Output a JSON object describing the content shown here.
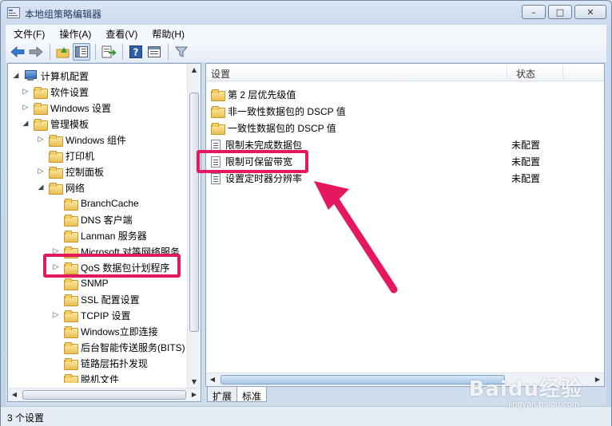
{
  "window": {
    "title": "本地组策略编辑器"
  },
  "menubar": {
    "items": [
      "文件(F)",
      "操作(A)",
      "查看(V)",
      "帮助(H)"
    ]
  },
  "toolbar": {
    "buttons": [
      "back-icon",
      "forward-icon",
      "up-folder-icon",
      "show-hide-tree-icon",
      "export-list-icon",
      "help-icon",
      "properties-view-icon",
      "filter-icon"
    ]
  },
  "tree": {
    "items": [
      {
        "label": "计算机配置",
        "icon": "computer-icon",
        "expander": "collapse"
      },
      {
        "label": "软件设置",
        "icon": "folder-icon",
        "expander": "expand"
      },
      {
        "label": "Windows 设置",
        "icon": "folder-icon",
        "expander": "expand"
      },
      {
        "label": "管理模板",
        "icon": "folder-icon",
        "expander": "collapse"
      },
      {
        "label": "Windows 组件",
        "icon": "folder-icon",
        "expander": "expand"
      },
      {
        "label": "打印机",
        "icon": "folder-icon",
        "expander": "none"
      },
      {
        "label": "控制面板",
        "icon": "folder-icon",
        "expander": "expand"
      },
      {
        "label": "网络",
        "icon": "folder-icon",
        "expander": "collapse"
      },
      {
        "label": "BranchCache",
        "icon": "folder-icon",
        "expander": "none"
      },
      {
        "label": "DNS 客户端",
        "icon": "folder-icon",
        "expander": "none"
      },
      {
        "label": "Lanman 服务器",
        "icon": "folder-icon",
        "expander": "none"
      },
      {
        "label": "Microsoft 对等网络服务",
        "icon": "folder-icon",
        "expander": "expand"
      },
      {
        "label": "QoS 数据包计划程序",
        "icon": "folder-icon",
        "expander": "expand",
        "highlighted": true
      },
      {
        "label": "SNMP",
        "icon": "folder-icon",
        "expander": "none"
      },
      {
        "label": "SSL 配置设置",
        "icon": "folder-icon",
        "expander": "none"
      },
      {
        "label": "TCPIP 设置",
        "icon": "folder-icon",
        "expander": "expand"
      },
      {
        "label": "Windows立即连接",
        "icon": "folder-icon",
        "expander": "none"
      },
      {
        "label": "后台智能传送服务(BITS)",
        "icon": "folder-icon",
        "expander": "none"
      },
      {
        "label": "链路层拓扑发现",
        "icon": "folder-icon",
        "expander": "none"
      },
      {
        "label": "脱机文件",
        "icon": "folder-icon",
        "expander": "none"
      }
    ]
  },
  "list": {
    "columns": [
      "设置",
      "状态"
    ],
    "rows": [
      {
        "name": "第 2 层优先级值",
        "state": "",
        "icon": "folder-icon"
      },
      {
        "name": "非一致性数据包的 DSCP 值",
        "state": "",
        "icon": "folder-icon"
      },
      {
        "name": "一致性数据包的 DSCP 值",
        "state": "",
        "icon": "folder-icon"
      },
      {
        "name": "限制未完成数据包",
        "state": "未配置",
        "icon": "setting-icon"
      },
      {
        "name": "限制可保留带宽",
        "state": "未配置",
        "icon": "setting-icon",
        "highlighted": true
      },
      {
        "name": "设置定时器分辨率",
        "state": "未配置",
        "icon": "setting-icon"
      }
    ]
  },
  "tabs": [
    "扩展",
    "标准"
  ],
  "status": {
    "text": "3 个设置"
  },
  "watermark": {
    "logo": "Baidu经验",
    "url": "jingyan.baidu.com"
  },
  "colors": {
    "highlight": "#e5175e",
    "window_bg": "#cfdcec"
  }
}
